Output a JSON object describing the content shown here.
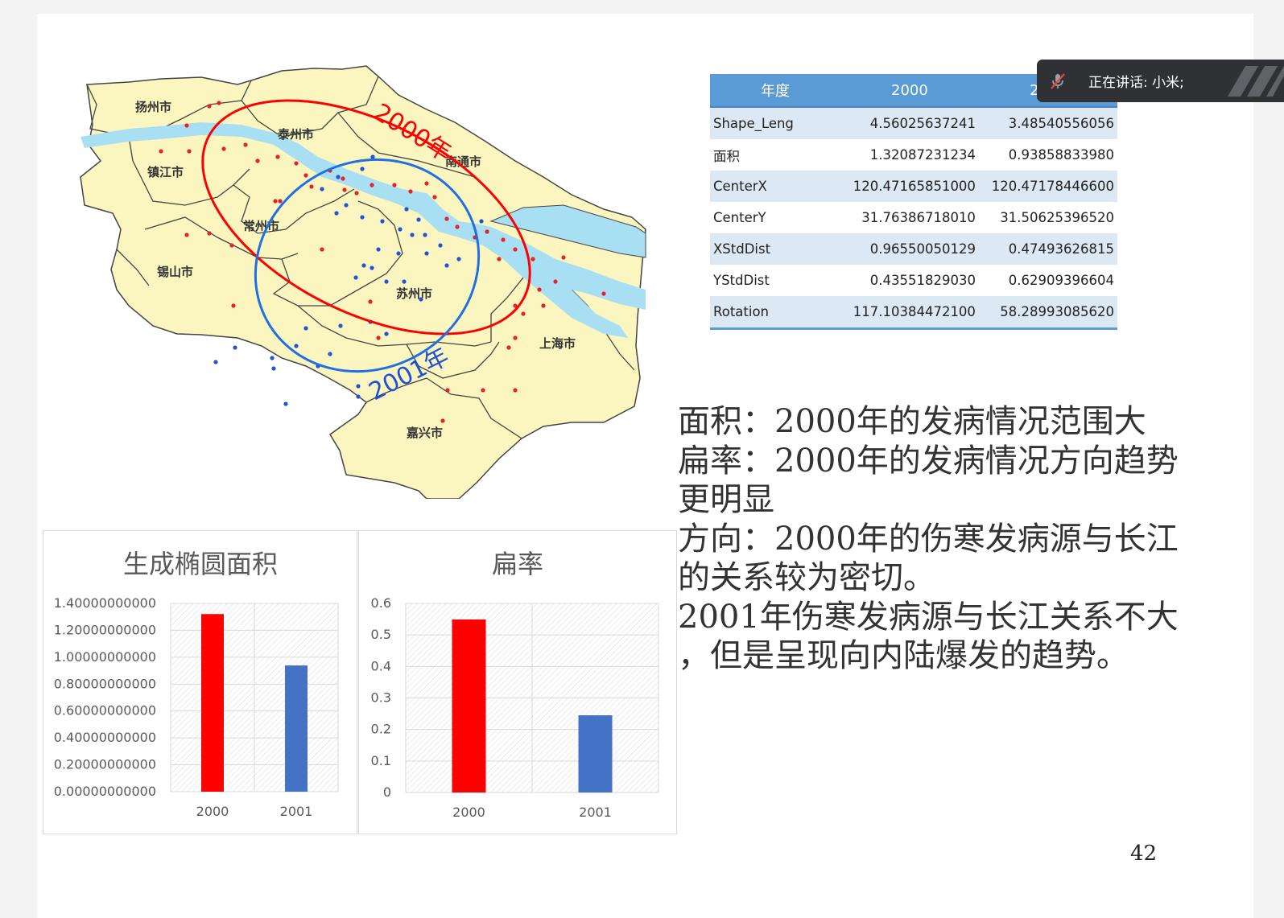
{
  "overlay": {
    "speaking_text": "正在讲话: 小米;"
  },
  "map": {
    "cities": [
      "扬州市",
      "泰州市",
      "南通市",
      "镇江市",
      "常州市",
      "锡山市",
      "苏州市",
      "上海市",
      "嘉兴市"
    ],
    "ellipse_2000_label": "2000年",
    "ellipse_2001_label": "2001年",
    "colors": {
      "land": "#fbf6bf",
      "river": "#a9dff2",
      "ellipse_2000": "#ff0000",
      "ellipse_2001": "#1f6fe5",
      "point_2000": "#e8202a",
      "point_2001": "#2253d6"
    }
  },
  "table": {
    "headers": [
      "年度",
      "2000",
      "2001"
    ],
    "rows": [
      [
        "Shape_Leng",
        "4.56025637241",
        "3.48540556056"
      ],
      [
        "面积",
        "1.32087231234",
        "0.93858833980"
      ],
      [
        "CenterX",
        "120.47165851000",
        "120.47178446600"
      ],
      [
        "CenterY",
        "31.76386718010",
        "31.50625396520"
      ],
      [
        "XStdDist",
        "0.96550050129",
        "0.47493626815"
      ],
      [
        "YStdDist",
        "0.43551829030",
        "0.62909396604"
      ],
      [
        "Rotation",
        "117.10384472100",
        "58.28993085620"
      ]
    ]
  },
  "analysis": {
    "lines": [
      "面积：2000年的发病情况范围大",
      "扁率：2000年的发病情况方向趋势",
      "更明显",
      "方向：2000年的伤寒发病源与长江",
      "的关系较为密切。",
      "2001年伤寒发病源与长江关系不大",
      "，但是呈现向内陆爆发的趋势。"
    ]
  },
  "chart_data": [
    {
      "type": "bar",
      "title": "生成椭圆面积",
      "categories": [
        "2000",
        "2001"
      ],
      "values": [
        1.32087231234,
        0.9385883398
      ],
      "colors": [
        "#ff0000",
        "#4472c4"
      ],
      "ylim": [
        0,
        1.4
      ],
      "yticks": [
        "1.40000000000",
        "1.20000000000",
        "1.00000000000",
        "0.80000000000",
        "0.60000000000",
        "0.40000000000",
        "0.20000000000",
        "0.00000000000"
      ],
      "grid": true
    },
    {
      "type": "bar",
      "title": "扁率",
      "categories": [
        "2000",
        "2001"
      ],
      "values": [
        0.549,
        0.245
      ],
      "colors": [
        "#ff0000",
        "#4472c4"
      ],
      "ylim": [
        0,
        0.6
      ],
      "yticks": [
        "0.6",
        "0.5",
        "0.4",
        "0.3",
        "0.2",
        "0.1",
        "0"
      ],
      "grid": true
    }
  ],
  "page": {
    "number": "42"
  }
}
